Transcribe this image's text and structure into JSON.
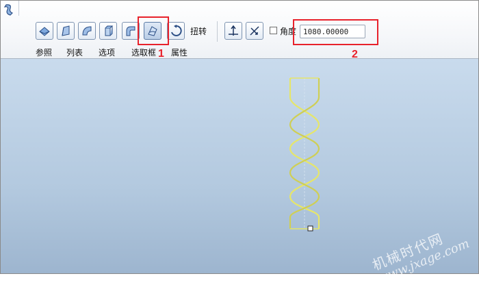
{
  "toolbar": {
    "twist_label": "扭转",
    "angle_label": "角度",
    "angle_value": "1080.00000",
    "tabs": [
      "参照",
      "列表",
      "选项",
      "选取框",
      "属性"
    ]
  },
  "annotations": [
    {
      "label": "1"
    },
    {
      "label": "2"
    }
  ],
  "watermark": {
    "line1": "机械时代网",
    "line2": "www.jxage.com"
  },
  "colors": {
    "annotation": "#e8212b",
    "model_stroke": "#e6e66a",
    "viewport_top": "#c9dbed",
    "viewport_bottom": "#9db5cf"
  },
  "icons": [
    "sweep-app-icon",
    "blend-surface-icon",
    "swept-blend-icon",
    "round-surface-icon",
    "extrude-block-icon",
    "pipe-icon",
    "twist-blend-icon",
    "rotate-icon",
    "normal-direction-icon",
    "flip-axis-icon"
  ]
}
